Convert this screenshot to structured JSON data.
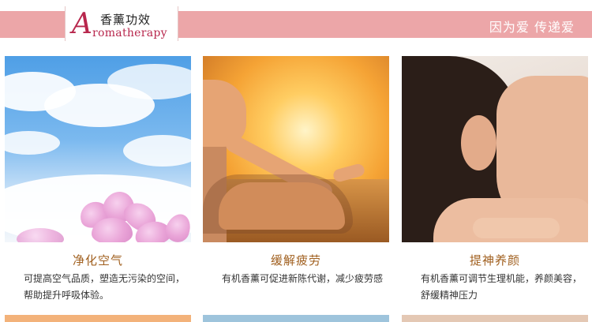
{
  "header": {
    "logo_initial": "A",
    "logo_cn": "香薰功效",
    "logo_en": "romatherapy",
    "slogan": "因为爱 传递爱",
    "band_color": "#eca6a8",
    "brand_color": "#b8274d"
  },
  "cards": [
    {
      "title": "净化空气",
      "desc": "可提高空气品质，塑造无污染的空间，帮助提升呼吸体验。",
      "photo": "sky-flowers-photo"
    },
    {
      "title": "缓解疲劳",
      "desc": "有机香薰可促进新陈代谢，减少疲劳感",
      "photo": "meditation-sunset-photo"
    },
    {
      "title": "提神养颜",
      "desc": "有机香薰可调节生理机能，养颜美容，舒缓精神压力",
      "photo": "spa-massage-photo"
    }
  ],
  "title_color": "#a05f1e"
}
